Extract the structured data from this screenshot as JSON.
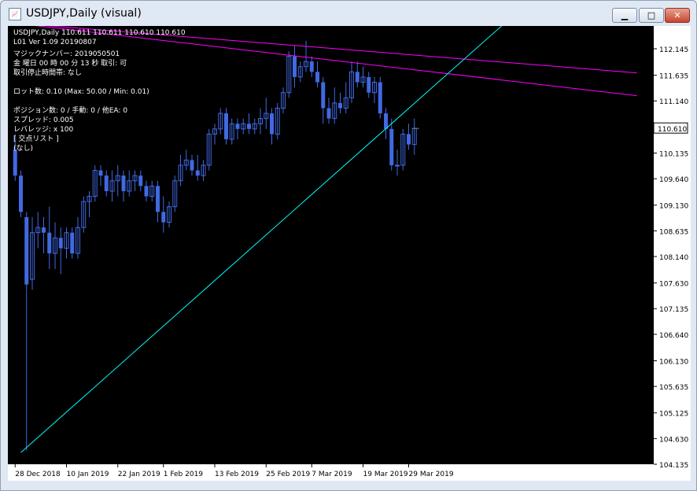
{
  "window": {
    "title": "USDJPY,Daily (visual)",
    "minimize_symbol": "▁",
    "maximize_symbol": "□",
    "close_symbol": "✕"
  },
  "info": {
    "symbol_line": "USDJPY,Daily  110.611 110.611 110.610 110.610",
    "version_line": "L01 Ver 1.09 20190807",
    "magic_line": "マジックナンバー: 2019050501",
    "time_line": "金 曜日 00 時 00 分 13 秒 取引: 可",
    "stop_line": "取引停止時間帯: なし",
    "lot_line": "ロット数: 0.10 (Max: 50.00 / Min: 0.01)",
    "position_line": "ポジション数: 0 / 手動: 0 / 他EA: 0",
    "spread_line": "スプレッド: 0.005",
    "leverage_line": "レバレッジ: x 100",
    "cross_list_line": "[ 交点リスト ]",
    "none_line": "(なし)"
  },
  "colors": {
    "background": "#000000",
    "candle": "#4169e1",
    "trend_upper": "#ff00ff",
    "trend_lower": "#00ffff",
    "bid_line": "#808080"
  },
  "chart_data": {
    "type": "candlestick",
    "symbol": "USDJPY",
    "timeframe": "Daily",
    "y_ticks": [
      112.145,
      111.635,
      111.14,
      110.64,
      110.135,
      109.64,
      109.13,
      108.635,
      108.14,
      107.63,
      107.135,
      106.64,
      106.13,
      105.635,
      105.125,
      104.63,
      104.135
    ],
    "current_price": 110.61,
    "ylim": [
      104.1,
      112.6
    ],
    "x_ticks": [
      {
        "index": 1,
        "label": "28 Dec 2018"
      },
      {
        "index": 10,
        "label": "10 Jan 2019"
      },
      {
        "index": 19,
        "label": "22 Jan 2019"
      },
      {
        "index": 27,
        "label": "1 Feb 2019"
      },
      {
        "index": 36,
        "label": "13 Feb 2019"
      },
      {
        "index": 45,
        "label": "25 Feb 2019"
      },
      {
        "index": 53,
        "label": "7 Mar 2019"
      },
      {
        "index": 62,
        "label": "19 Mar 2019"
      },
      {
        "index": 70,
        "label": "29 Mar 2019"
      }
    ],
    "candles": [
      [
        110.2,
        110.5,
        109.6,
        109.7
      ],
      [
        109.7,
        109.8,
        108.9,
        109.0
      ],
      [
        108.9,
        109.0,
        104.4,
        107.6
      ],
      [
        107.7,
        108.9,
        107.5,
        108.6
      ],
      [
        108.6,
        109.0,
        108.3,
        108.7
      ],
      [
        108.7,
        108.9,
        108.2,
        108.6
      ],
      [
        108.6,
        109.1,
        107.9,
        108.2
      ],
      [
        108.2,
        108.8,
        107.9,
        108.5
      ],
      [
        108.5,
        108.7,
        107.8,
        108.3
      ],
      [
        108.3,
        108.7,
        108.1,
        108.6
      ],
      [
        108.6,
        108.7,
        108.1,
        108.2
      ],
      [
        108.2,
        108.9,
        108.1,
        108.7
      ],
      [
        108.7,
        109.3,
        108.6,
        109.2
      ],
      [
        109.2,
        109.4,
        108.9,
        109.3
      ],
      [
        109.3,
        109.9,
        109.2,
        109.8
      ],
      [
        109.8,
        109.9,
        109.5,
        109.7
      ],
      [
        109.7,
        109.8,
        109.3,
        109.4
      ],
      [
        109.4,
        109.8,
        109.2,
        109.6
      ],
      [
        109.6,
        109.9,
        109.3,
        109.7
      ],
      [
        109.7,
        109.8,
        109.2,
        109.4
      ],
      [
        109.4,
        109.8,
        109.3,
        109.6
      ],
      [
        109.6,
        109.8,
        109.4,
        109.7
      ],
      [
        109.7,
        109.8,
        109.4,
        109.5
      ],
      [
        109.5,
        109.6,
        109.2,
        109.3
      ],
      [
        109.3,
        109.6,
        109.2,
        109.5
      ],
      [
        109.5,
        109.6,
        108.8,
        109.0
      ],
      [
        109.0,
        109.3,
        108.6,
        108.8
      ],
      [
        108.8,
        109.2,
        108.7,
        109.1
      ],
      [
        109.1,
        109.7,
        109.0,
        109.6
      ],
      [
        109.6,
        110.1,
        109.5,
        109.9
      ],
      [
        109.9,
        110.2,
        109.8,
        110.0
      ],
      [
        110.0,
        110.1,
        109.7,
        109.8
      ],
      [
        109.8,
        110.1,
        109.6,
        109.7
      ],
      [
        109.7,
        110.0,
        109.6,
        109.9
      ],
      [
        109.9,
        110.6,
        109.8,
        110.5
      ],
      [
        110.5,
        110.7,
        110.3,
        110.6
      ],
      [
        110.6,
        111.0,
        110.5,
        110.9
      ],
      [
        110.9,
        111.0,
        110.3,
        110.4
      ],
      [
        110.4,
        110.8,
        110.3,
        110.7
      ],
      [
        110.7,
        110.8,
        110.4,
        110.6
      ],
      [
        110.6,
        110.8,
        110.5,
        110.7
      ],
      [
        110.7,
        110.9,
        110.5,
        110.6
      ],
      [
        110.6,
        110.8,
        110.5,
        110.7
      ],
      [
        110.7,
        111.0,
        110.5,
        110.8
      ],
      [
        110.8,
        111.2,
        110.6,
        110.9
      ],
      [
        110.9,
        111.0,
        110.3,
        110.5
      ],
      [
        110.5,
        111.1,
        110.4,
        111.0
      ],
      [
        111.0,
        111.4,
        110.9,
        111.3
      ],
      [
        111.3,
        112.1,
        111.2,
        112.0
      ],
      [
        112.0,
        112.2,
        111.4,
        111.6
      ],
      [
        111.6,
        111.9,
        111.5,
        111.8
      ],
      [
        111.8,
        112.3,
        111.7,
        111.9
      ],
      [
        111.9,
        112.0,
        111.6,
        111.7
      ],
      [
        111.7,
        111.9,
        111.4,
        111.5
      ],
      [
        111.5,
        111.6,
        110.7,
        111.0
      ],
      [
        111.0,
        111.2,
        110.7,
        110.8
      ],
      [
        110.8,
        111.4,
        110.7,
        111.1
      ],
      [
        111.1,
        111.3,
        110.9,
        111.0
      ],
      [
        111.0,
        111.5,
        110.9,
        111.2
      ],
      [
        111.2,
        111.9,
        111.1,
        111.7
      ],
      [
        111.7,
        111.9,
        111.4,
        111.5
      ],
      [
        111.5,
        111.8,
        111.4,
        111.6
      ],
      [
        111.6,
        111.7,
        111.2,
        111.3
      ],
      [
        111.3,
        111.6,
        111.1,
        111.5
      ],
      [
        111.5,
        111.6,
        110.8,
        110.9
      ],
      [
        110.9,
        111.0,
        110.4,
        110.6
      ],
      [
        110.6,
        110.8,
        109.8,
        109.9
      ],
      [
        109.9,
        110.2,
        109.7,
        109.9
      ],
      [
        109.9,
        110.6,
        109.8,
        110.5
      ],
      [
        110.5,
        110.7,
        110.2,
        110.3
      ],
      [
        110.3,
        110.8,
        110.1,
        110.61
      ]
    ],
    "trendlines": [
      {
        "color": "#ff00ff",
        "from": [
          0,
          112.65
        ],
        "to": [
          110,
          111.68
        ]
      },
      {
        "color": "#ff00ff",
        "from": [
          0,
          112.65
        ],
        "to": [
          110,
          111.24
        ]
      },
      {
        "color": "#00ffff",
        "from": [
          2,
          104.36
        ],
        "to": [
          89,
          112.85
        ]
      }
    ]
  }
}
